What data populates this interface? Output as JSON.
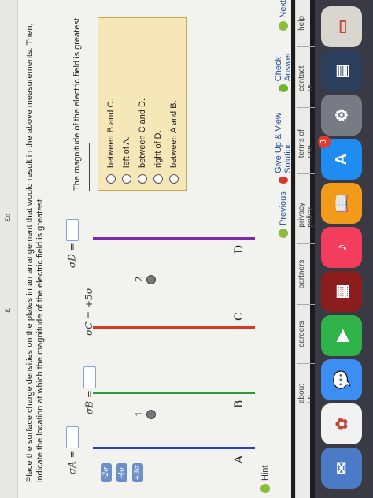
{
  "header": {
    "eps_symbol": "ε",
    "eps_symbol_zero": "ε₀"
  },
  "problem": {
    "text": "Place the surface charge densities on the plates in an arrangement that would result in the above measurements. Then, indicate the location at which the magnitude of the electric field is greatest."
  },
  "plates": [
    {
      "letter": "A",
      "sigma_label": "σA =",
      "value": "",
      "color": "#2a3ec8"
    },
    {
      "letter": "B",
      "sigma_label": "σB =",
      "value": "",
      "color": "#2e9a35"
    },
    {
      "letter": "C",
      "sigma_label": "σC = +5σ",
      "value": "",
      "color": "#d23a2a"
    },
    {
      "letter": "D",
      "sigma_label": "σD =",
      "value": "",
      "color": "#7a2ca8"
    }
  ],
  "points": [
    {
      "label": "1"
    },
    {
      "label": "2"
    }
  ],
  "palette": [
    "-2σ",
    "-4σ",
    "+3σ"
  ],
  "question": {
    "prompt": "The magnitude of the electric field is greatest",
    "options": [
      "between B and C.",
      "left of A.",
      "between C and D.",
      "right of D.",
      "between A and B."
    ]
  },
  "hint_label": "Hint",
  "navigation": {
    "previous": "Previous",
    "give_up": "Give Up & View Solution",
    "check": "Check Answer",
    "next": "Next"
  },
  "footer_links": [
    "about us",
    "careers",
    "partners",
    "privacy policy",
    "terms of use",
    "contact us",
    "help"
  ],
  "dock": {
    "items": [
      {
        "name": "preview-icon",
        "color": "#4b7bc6",
        "glyph": "✉"
      },
      {
        "name": "photos-icon",
        "color": "#f2f2f2",
        "glyph": "✿"
      },
      {
        "name": "messages-icon",
        "color": "#3d8ef2",
        "glyph": "💬"
      },
      {
        "name": "facetime-icon",
        "color": "#2fb34a",
        "glyph": "▶"
      },
      {
        "name": "photo-booth-icon",
        "color": "#8c1d1d",
        "glyph": "▦"
      },
      {
        "name": "itunes-icon",
        "color": "#f43c5c",
        "glyph": "♪"
      },
      {
        "name": "ibooks-icon",
        "color": "#f29a1a",
        "glyph": "📖"
      },
      {
        "name": "app-store-icon",
        "color": "#1e8cf0",
        "glyph": "A",
        "badge": "3"
      },
      {
        "name": "system-preferences-icon",
        "color": "#777c84",
        "glyph": "⚙"
      },
      {
        "name": "certificate-icon",
        "color": "#2b3f5c",
        "glyph": "▤"
      },
      {
        "name": "document-icon",
        "color": "#d8d6ce",
        "glyph": "▭"
      }
    ]
  }
}
